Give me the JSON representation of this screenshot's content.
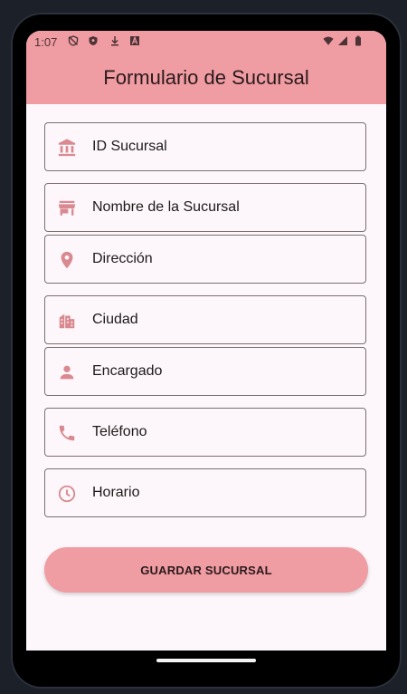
{
  "status_bar": {
    "time": "1:07",
    "left_icons": [
      "shield-off-icon",
      "shield-icon",
      "download-icon",
      "a-badge-icon"
    ],
    "right_icons": [
      "wifi-icon",
      "signal-icon",
      "battery-icon"
    ]
  },
  "app_bar": {
    "title": "Formulario de Sucursal"
  },
  "form": {
    "fields": [
      {
        "name": "id",
        "label": "ID Sucursal",
        "icon": "bank-icon"
      },
      {
        "name": "nombre",
        "label": "Nombre de la Sucursal",
        "icon": "store-icon"
      },
      {
        "name": "direccion",
        "label": "Dirección",
        "icon": "location-pin-icon"
      },
      {
        "name": "ciudad",
        "label": "Ciudad",
        "icon": "city-icon"
      },
      {
        "name": "encargado",
        "label": "Encargado",
        "icon": "person-icon"
      },
      {
        "name": "telefono",
        "label": "Teléfono",
        "icon": "phone-icon"
      },
      {
        "name": "horario",
        "label": "Horario",
        "icon": "clock-icon"
      }
    ],
    "save_label": "GUARDAR SUCURSAL"
  },
  "colors": {
    "accent": "#ef9ca2",
    "icon": "#d98a90",
    "background": "#fdf7fb",
    "border": "#7b6f72"
  }
}
